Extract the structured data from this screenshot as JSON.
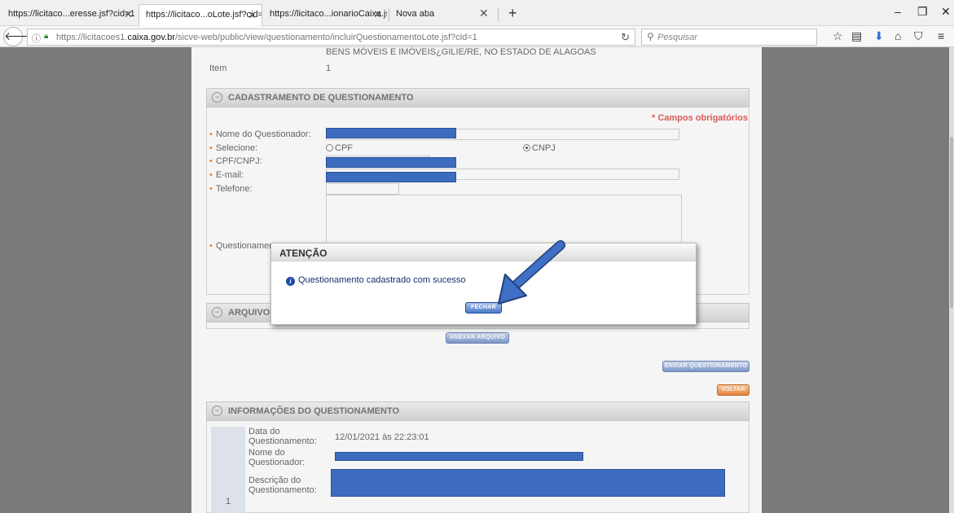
{
  "browser": {
    "tabs": [
      {
        "label": "https://licitaco...eresse.jsf?cid=1"
      },
      {
        "label": "https://licitaco...oLote.jsf?cid=1"
      },
      {
        "label": "https://licitaco...ionarioCaixa.jsf"
      },
      {
        "label": "Nova aba"
      }
    ],
    "url_prefix": "https://licitacoes1.",
    "url_domain": "caixa.gov.br",
    "url_path": "/sicve-web/public/view/questionamento/incluirQuestionamentoLote.jsf?cid=1",
    "search_placeholder": "Pesquisar"
  },
  "page": {
    "objeto_text": "BENS MÓVEIS E IMÓVEIS¿GILIE/RE, NO ESTADO DE ALAGOAS",
    "item_label": "Item",
    "item_value": "1",
    "cadastro": {
      "title": "CADASTRAMENTO DE QUESTIONAMENTO",
      "required_note": "* Campos obrigatórios",
      "fields": {
        "nome": "Nome do Questionador:",
        "selecione": "Selecione:",
        "cpf_cnpj": "CPF/CNPJ:",
        "email": "E-mail:",
        "telefone": "Telefone:",
        "questionamento": "Questionamento:"
      },
      "radio_cpf": "CPF",
      "radio_cnpj": "CNPJ",
      "selected": "CNPJ"
    },
    "arquivos": {
      "title": "ARQUIVOS"
    },
    "buttons": {
      "anexar": "ANEXAR ARQUIVO",
      "enviar": "ENVIAR QUESTIONAMENTO",
      "voltar": "VOLTAR"
    },
    "informacoes": {
      "title": "INFORMAÇÕES DO QUESTIONAMENTO",
      "row_number": "1",
      "data_label": "Data do Questionamento:",
      "data_value": "12/01/2021 às 22:23:01",
      "nome_label": "Nome do Questionador:",
      "descricao_label": "Descrição do Questionamento:"
    }
  },
  "modal": {
    "title": "ATENÇÃO",
    "message": "Questionamento cadastrado com sucesso",
    "close_button": "FECHAR"
  },
  "colors": {
    "redaction": "#4071c7",
    "required": "#e85c5c",
    "annotation_arrow": "#3f6fc6"
  }
}
